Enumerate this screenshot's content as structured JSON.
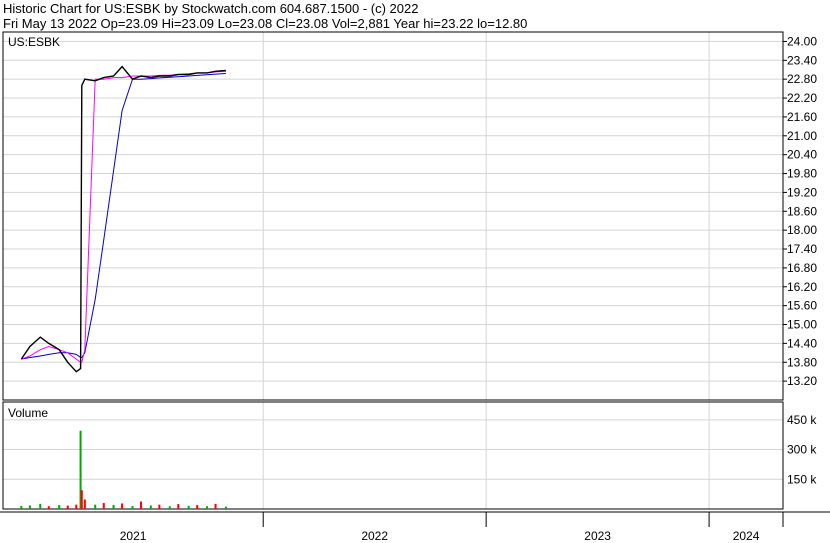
{
  "header": {
    "line1": "Historic Chart for US:ESBK by Stockwatch.com 604.687.1500 - (c) 2022",
    "line2": "Fri May 13 2022  Op=23.09  Hi=23.09  Lo=23.08  Cl=23.08  Vol=2,881  Year hi=23.22  lo=12.80"
  },
  "chart_data": [
    {
      "type": "line",
      "panel_label": "US:ESBK",
      "ylim": [
        12.6,
        24.3
      ],
      "y_ticks": [
        "24.00",
        "23.40",
        "22.80",
        "22.20",
        "21.60",
        "21.00",
        "20.40",
        "19.80",
        "19.20",
        "18.60",
        "18.00",
        "17.40",
        "16.80",
        "16.20",
        "15.60",
        "15.00",
        "14.40",
        "13.80",
        "13.20"
      ],
      "x": [
        "2020-12-01",
        "2020-12-15",
        "2021-01-01",
        "2021-01-15",
        "2021-02-01",
        "2021-02-15",
        "2021-03-01",
        "2021-03-08",
        "2021-03-10",
        "2021-03-15",
        "2021-04-01",
        "2021-04-15",
        "2021-05-01",
        "2021-05-15",
        "2021-06-01",
        "2021-06-15",
        "2021-07-01",
        "2021-07-15",
        "2021-08-01",
        "2021-08-15",
        "2021-09-01",
        "2021-09-15",
        "2021-10-01",
        "2021-10-15",
        "2021-11-01"
      ],
      "series": [
        {
          "values": [
            13.9,
            14.3,
            14.6,
            14.4,
            14.2,
            13.8,
            13.5,
            13.6,
            22.6,
            22.8,
            22.75,
            22.85,
            22.9,
            23.2,
            22.8,
            22.9,
            22.85,
            22.9,
            22.9,
            22.95,
            22.95,
            23.0,
            23.0,
            23.05,
            23.08
          ],
          "color": "#000000"
        },
        {
          "values": [
            13.9,
            14.0,
            14.2,
            14.3,
            14.2,
            14.1,
            13.9,
            13.8,
            13.8,
            14.2,
            22.8,
            22.8,
            22.85,
            22.85,
            22.9,
            22.9,
            22.9,
            22.92,
            22.93,
            22.95,
            22.97,
            23.0,
            23.0,
            23.03,
            23.05
          ],
          "color": "#ff00ff"
        },
        {
          "values": [
            13.9,
            13.95,
            14.0,
            14.05,
            14.1,
            14.1,
            14.05,
            13.95,
            13.95,
            14.1,
            15.8,
            17.7,
            19.9,
            21.8,
            22.8,
            22.8,
            22.82,
            22.84,
            22.86,
            22.88,
            22.9,
            22.92,
            22.94,
            22.96,
            22.98
          ],
          "color": "#0000cc"
        }
      ]
    },
    {
      "type": "bar",
      "panel_label": "Volume",
      "ylim": [
        0,
        540000
      ],
      "y_ticks": [
        "450 k",
        "300 k",
        "150 k"
      ],
      "x": [
        "2020-12-01",
        "2020-12-15",
        "2021-01-01",
        "2021-01-15",
        "2021-02-01",
        "2021-02-15",
        "2021-03-01",
        "2021-03-08",
        "2021-03-10",
        "2021-03-15",
        "2021-04-01",
        "2021-04-15",
        "2021-05-01",
        "2021-05-15",
        "2021-06-01",
        "2021-06-15",
        "2021-07-01",
        "2021-07-15",
        "2021-08-01",
        "2021-08-15",
        "2021-09-01",
        "2021-09-15",
        "2021-10-01",
        "2021-10-15",
        "2021-11-01"
      ],
      "values": [
        15000,
        18000,
        26000,
        14000,
        20000,
        17000,
        22000,
        395000,
        95000,
        48000,
        22000,
        30000,
        20000,
        28000,
        15000,
        38000,
        18000,
        22000,
        14000,
        25000,
        16000,
        20000,
        14000,
        26000,
        12000
      ],
      "colors": [
        "#00aa00",
        "#00aa00",
        "#00aa00",
        "#ff0000",
        "#00aa00",
        "#ff0000",
        "#ff0000",
        "#00aa00",
        "#ff0000",
        "#ff0000",
        "#00aa00",
        "#ff0000",
        "#00aa00",
        "#ff0000",
        "#00aa00",
        "#ff0000",
        "#00aa00",
        "#ff0000",
        "#00aa00",
        "#ff0000",
        "#00aa00",
        "#ff0000",
        "#00aa00",
        "#ff0000",
        "#00aa00"
      ]
    }
  ],
  "x_axis": {
    "ticks": [
      {
        "label": "2021",
        "date": "2021-01-01"
      },
      {
        "label": "2022",
        "date": "2022-01-01"
      },
      {
        "label": "2023",
        "date": "2023-01-01"
      },
      {
        "label": "2024",
        "date": "2024-01-01"
      }
    ],
    "range": [
      "2020-11-01",
      "2024-05-01"
    ]
  }
}
